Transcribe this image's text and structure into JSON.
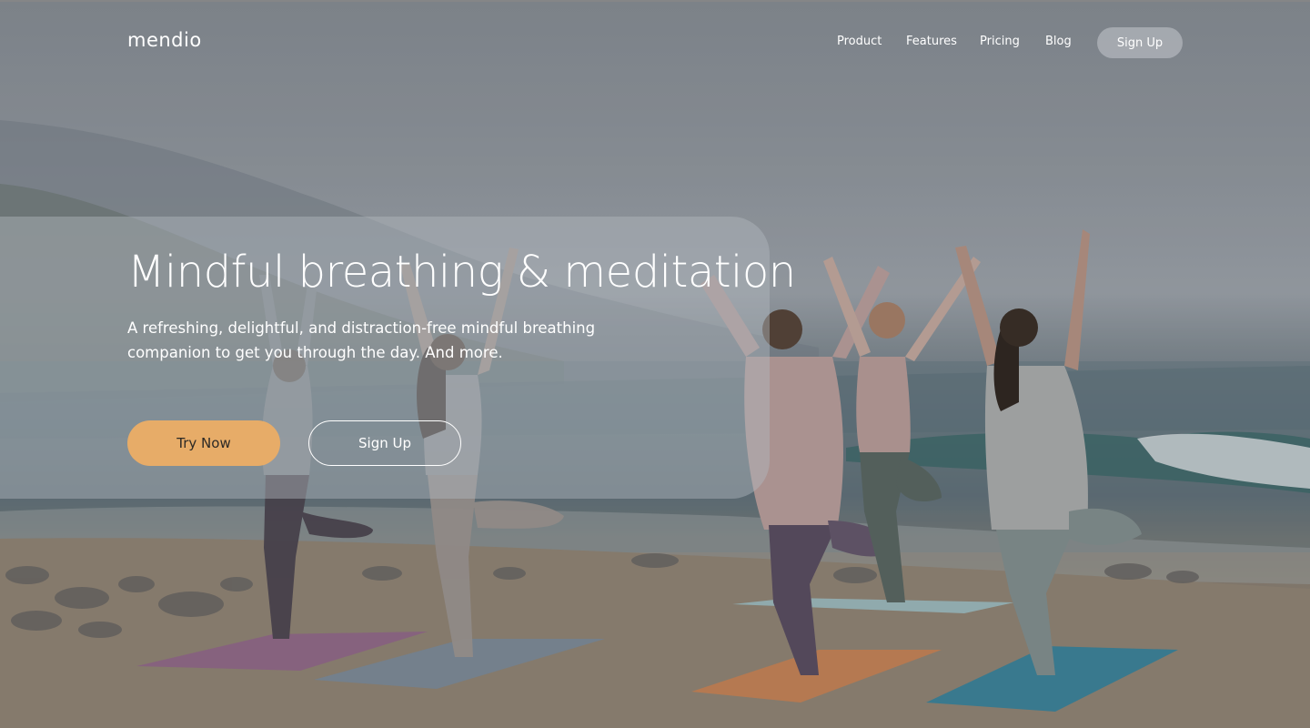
{
  "brand": {
    "logo": "mendio"
  },
  "nav": {
    "links": [
      "Product",
      "Features",
      "Pricing",
      "Blog"
    ],
    "signup_label": "Sign Up"
  },
  "hero": {
    "title": "Mindful breathing & meditation",
    "subtitle": "A refreshing, delightful, and distraction-free mindful breathing companion to get you through the day. And more.",
    "primary_cta": "Try Now",
    "secondary_cta": "Sign Up",
    "background_image": "yoga-on-beach-photo"
  },
  "colors": {
    "primary_button": "#e7ac68",
    "nav_signup_bg": "#b0b5ba",
    "card_overlay": "#b2b8be"
  }
}
